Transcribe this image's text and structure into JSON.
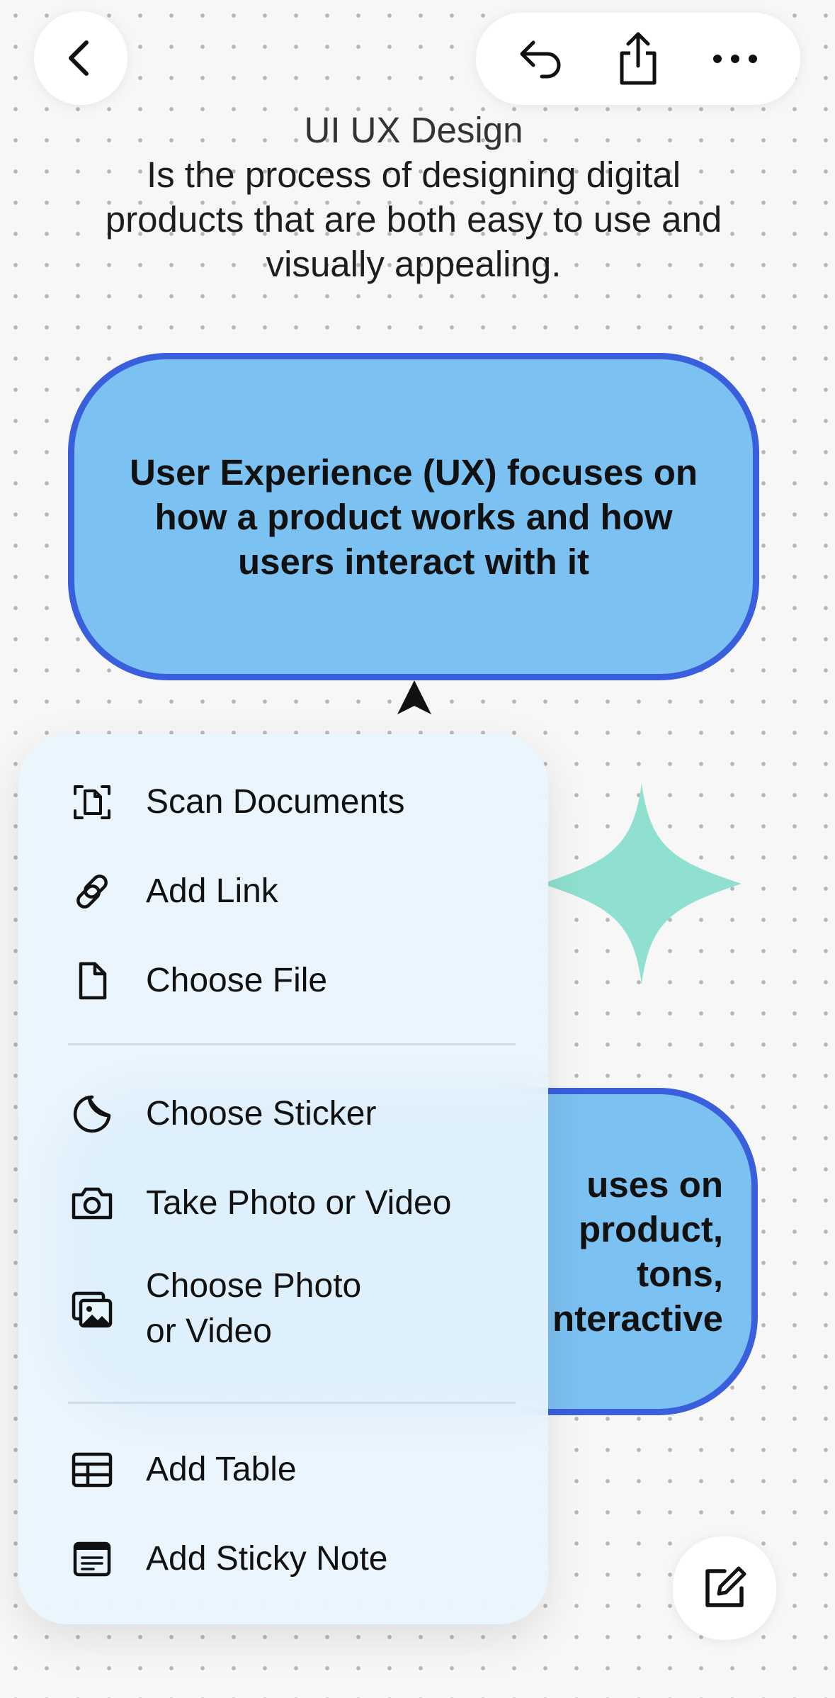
{
  "header": {
    "title": "UI UX Design",
    "line1": "Is the process of designing digital",
    "line2": "products that are both easy to use and",
    "line3": "visually appealing."
  },
  "cards": {
    "ux": "User Experience (UX) focuses on how a product works and how users interact with it",
    "ui_line1": "uses on",
    "ui_line2": "product,",
    "ui_line3": "tons,",
    "ui_line4": "nteractive"
  },
  "menu": {
    "scan": "Scan Documents",
    "link": "Add Link",
    "file": "Choose File",
    "sticker": "Choose Sticker",
    "photo": "Take Photo or Video",
    "choose_photo_1": "Choose Photo",
    "choose_photo_2": "or Video",
    "table": "Add Table",
    "sticky": "Add Sticky Note"
  },
  "icons": {
    "back": "chevron-left-icon",
    "undo": "undo-icon",
    "share": "share-icon",
    "more": "ellipsis-icon",
    "compose": "compose-icon"
  },
  "colors": {
    "card_fill": "#7bc1f1",
    "card_border": "#3a5fdd",
    "sparkle": "#8fe0d0",
    "menu_bg": "#e9f5fd"
  }
}
